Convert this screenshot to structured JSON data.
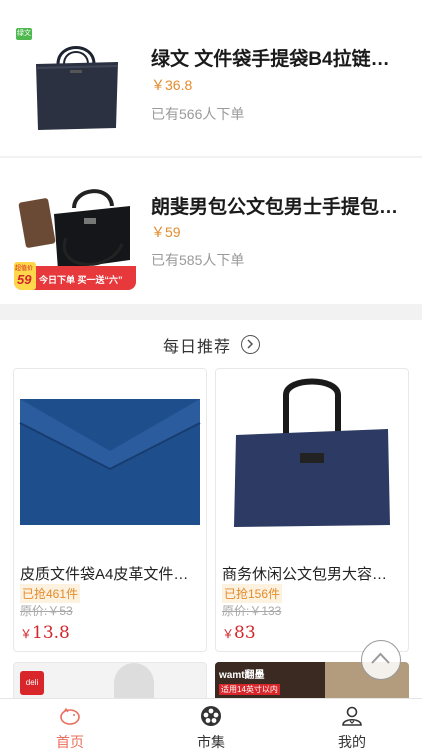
{
  "products": [
    {
      "title": "绿文 文件袋手提袋B4拉链…",
      "price": "￥36.8",
      "sold": "已有566人下单",
      "badge": "绿文"
    },
    {
      "title": "朗斐男包公文包男士手提包…",
      "price": "￥59",
      "sold": "已有585人下单",
      "promo_price": "59",
      "promo_text": "今日下单 买一送“六”",
      "promo_tag": "超值价"
    }
  ],
  "daily": {
    "title": "每日推荐"
  },
  "cards": [
    {
      "title": "皮质文件袋A4皮革文件…",
      "grabbed": "已抢461件",
      "original": "原价:￥53",
      "yen": "￥",
      "price": "13.8"
    },
    {
      "title": "商务休闲公文包男大容…",
      "grabbed": "已抢156件",
      "original": "原价:￥133",
      "yen": "￥",
      "price": "83"
    }
  ],
  "mini": [
    {
      "logo": "deli"
    },
    {
      "logo": "wamt翻墨",
      "sub": "适用14英寸以内"
    }
  ],
  "tabs": [
    {
      "label": "首页",
      "icon": "piggy-icon",
      "active": true
    },
    {
      "label": "市集",
      "icon": "flower-icon",
      "active": false
    },
    {
      "label": "我的",
      "icon": "user-icon",
      "active": false
    }
  ],
  "colors": {
    "price_orange": "#e38c2d",
    "price_red": "#d1262b",
    "tab_active": "#e9705e"
  }
}
